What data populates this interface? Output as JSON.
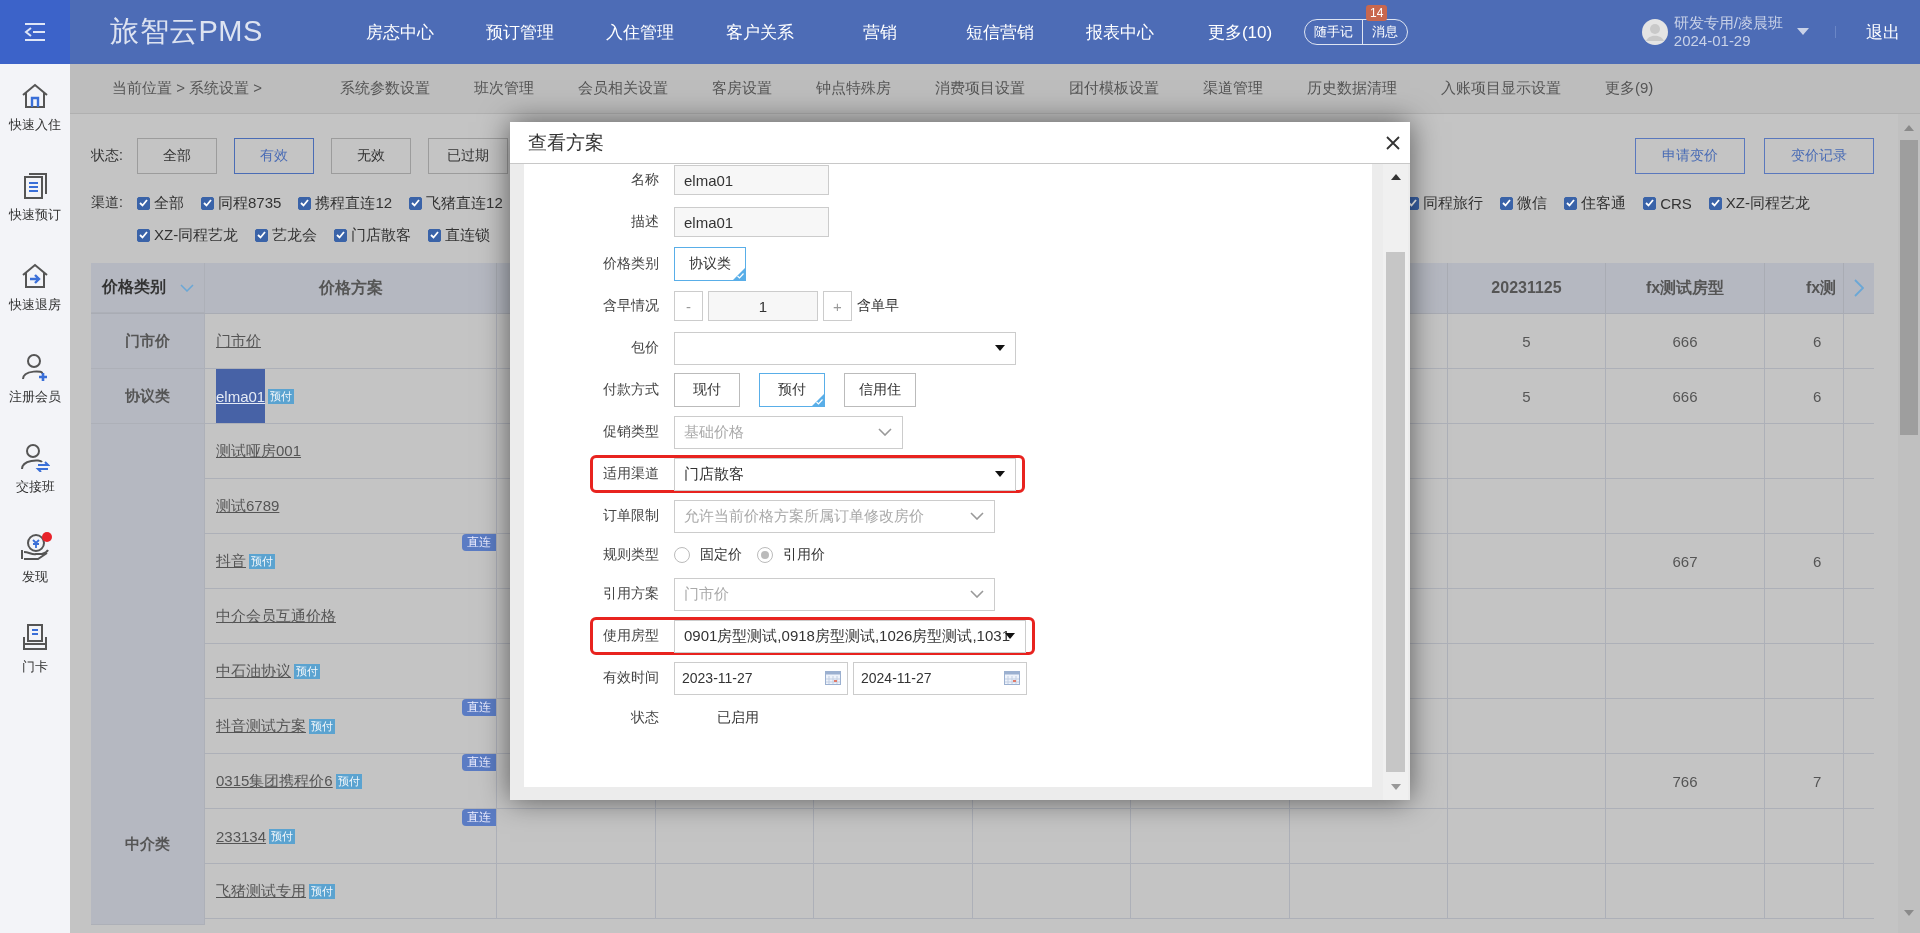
{
  "header": {
    "logo": "旅智云PMS",
    "nav": [
      "房态中心",
      "预订管理",
      "入住管理",
      "客户关系",
      "营销",
      "短信营销",
      "报表中心",
      "更多(10)"
    ],
    "notes": "随手记",
    "messages": "消息",
    "message_count": "14",
    "user": "研发专用/凌晨班",
    "date": "2024-01-29",
    "logout": "退出"
  },
  "sidebar": [
    {
      "label": "快速入住",
      "dot": false
    },
    {
      "label": "快速预订",
      "dot": false
    },
    {
      "label": "快速退房",
      "dot": false
    },
    {
      "label": "注册会员",
      "dot": false
    },
    {
      "label": "交接班",
      "dot": false
    },
    {
      "label": "发现",
      "dot": true
    },
    {
      "label": "门卡",
      "dot": false
    }
  ],
  "breadcrumb": {
    "path": "当前位置 > 系统设置 >",
    "tabs": [
      "系统参数设置",
      "班次管理",
      "会员相关设置",
      "客房设置",
      "钟点特殊房",
      "消费项目设置",
      "团付模板设置",
      "渠道管理",
      "历史数据清理",
      "入账项目显示设置",
      "更多(9)"
    ]
  },
  "filters": {
    "status_label": "状态:",
    "status_options": [
      {
        "label": "全部",
        "selected": false
      },
      {
        "label": "有效",
        "selected": true
      },
      {
        "label": "无效",
        "selected": false
      },
      {
        "label": "已过期",
        "selected": false
      }
    ],
    "actions": [
      "申请变价",
      "变价记录"
    ],
    "channel_label": "渠道:",
    "channels_left": [
      {
        "label": "全部",
        "checked": true
      },
      {
        "label": "同程8735",
        "checked": true
      },
      {
        "label": "携程直连12",
        "checked": true
      },
      {
        "label": "飞猪直连12",
        "checked": true
      }
    ],
    "channels_right": [
      {
        "label": "同程旅行",
        "checked": true
      },
      {
        "label": "微信",
        "checked": true
      },
      {
        "label": "住客通",
        "checked": true
      },
      {
        "label": "CRS",
        "checked": true
      },
      {
        "label": "XZ-同程艺龙",
        "checked": true
      }
    ],
    "channels_second_line": [
      {
        "label": "XZ-同程艺龙",
        "checked": true
      },
      {
        "label": "艺龙会",
        "checked": true
      },
      {
        "label": "门店散客",
        "checked": true
      },
      {
        "label": "直连锁",
        "checked": true
      }
    ]
  },
  "table": {
    "columns": [
      "价格类别",
      "价格方案",
      "20231125",
      "fx测试房型",
      "fx测"
    ],
    "groups": [
      {
        "category": "门市价",
        "rows": [
          {
            "plan": "门市价",
            "selected": false,
            "column_3": "5",
            "column_4": "666",
            "column_5": "6"
          }
        ]
      },
      {
        "category": "协议类",
        "rows": [
          {
            "plan": "elma01",
            "tag": "预付",
            "selected": true,
            "column_3": "5",
            "column_4": "666",
            "column_5": "6"
          }
        ]
      },
      {
        "category": "中介类",
        "rows": [
          {
            "plan": "测试哑房001",
            "selected": false
          },
          {
            "plan": "测试6789",
            "selected": false
          },
          {
            "plan": "抖音",
            "tag": "预付",
            "badge": "直连",
            "selected": false,
            "column_4": "667",
            "column_5": "6"
          },
          {
            "plan": "中介会员互通价格",
            "selected": false
          },
          {
            "plan": "中石油协议",
            "tag": "预付",
            "selected": false
          },
          {
            "plan": "抖音测试方案",
            "tag": "预付",
            "badge": "直连",
            "selected": false
          },
          {
            "plan": "0315集团携程价6",
            "tag": "预付",
            "badge": "直连",
            "selected": false,
            "column_4": "766",
            "column_5": "7"
          },
          {
            "plan": "233134",
            "tag": "预付",
            "badge": "直连",
            "selected": false
          },
          {
            "plan": "飞猪测试专用",
            "tag": "预付",
            "selected": false
          }
        ]
      }
    ]
  },
  "dialog": {
    "title": "查看方案",
    "fields": [
      {
        "kind": "text",
        "label": "名称",
        "value": "elma01"
      },
      {
        "kind": "text",
        "label": "描述",
        "value": "elma01"
      },
      {
        "kind": "choice",
        "label": "价格类别",
        "options": [
          {
            "label": "协议类",
            "selected": true
          }
        ]
      },
      {
        "kind": "counter",
        "label": "含早情况",
        "minus": "-",
        "value": "1",
        "plus": "+",
        "suffix": "含单早"
      },
      {
        "kind": "select",
        "label": "包价",
        "disabled": false,
        "highlighted": false
      },
      {
        "kind": "choice",
        "label": "付款方式",
        "options": [
          {
            "label": "现付",
            "selected": false
          },
          {
            "label": "预付",
            "selected": true
          },
          {
            "label": "信用住",
            "selected": false
          }
        ]
      },
      {
        "kind": "select",
        "label": "促销类型",
        "value": "基础价格",
        "disabled": true,
        "highlighted": false
      },
      {
        "kind": "select",
        "label": "适用渠道",
        "value": "门店散客",
        "disabled": false,
        "highlighted": true
      },
      {
        "kind": "select",
        "label": "订单限制",
        "value": "允许当前价格方案所属订单修改房价",
        "disabled": true,
        "highlighted": false
      },
      {
        "kind": "radio",
        "label": "规则类型",
        "options": [
          {
            "label": "固定价",
            "selected": false
          },
          {
            "label": "引用价",
            "selected": true
          }
        ]
      },
      {
        "kind": "select",
        "label": "引用方案",
        "value": "门市价",
        "disabled": true,
        "highlighted": false
      },
      {
        "kind": "select",
        "label": "使用房型",
        "value": "0901房型测试,0918房型测试,1026房型测试,1031",
        "disabled": false,
        "highlighted": true
      },
      {
        "kind": "daterange",
        "label": "有效时间",
        "from": "2023-11-27",
        "to": "2024-11-27"
      },
      {
        "kind": "static",
        "label": "状态",
        "value": "已启用"
      }
    ]
  }
}
